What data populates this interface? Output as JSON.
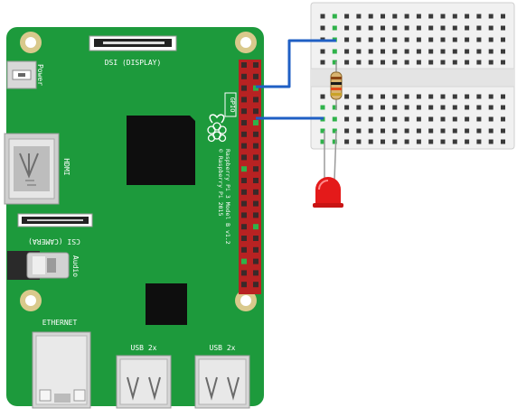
{
  "board": {
    "dsi_label": "DSI (DISPLAY)",
    "power_label": "Power",
    "hdmi_label": "HDMI",
    "csi_label": "CSI (CAMERA)",
    "audio_label": "Audio",
    "ethernet_label": "ETHERNET",
    "usb1_label": "USB 2x",
    "usb2_label": "USB 2x",
    "gpio_label": "GPIO",
    "model_line1": "Raspberry Pi 3 Model B v1.2",
    "model_line2": "© Raspberry Pi 2015"
  },
  "colors": {
    "board_green": "#1d9a3c",
    "wire_blue": "#1f5fc4",
    "led_red": "#e41a1a",
    "header_red": "#b82222"
  }
}
